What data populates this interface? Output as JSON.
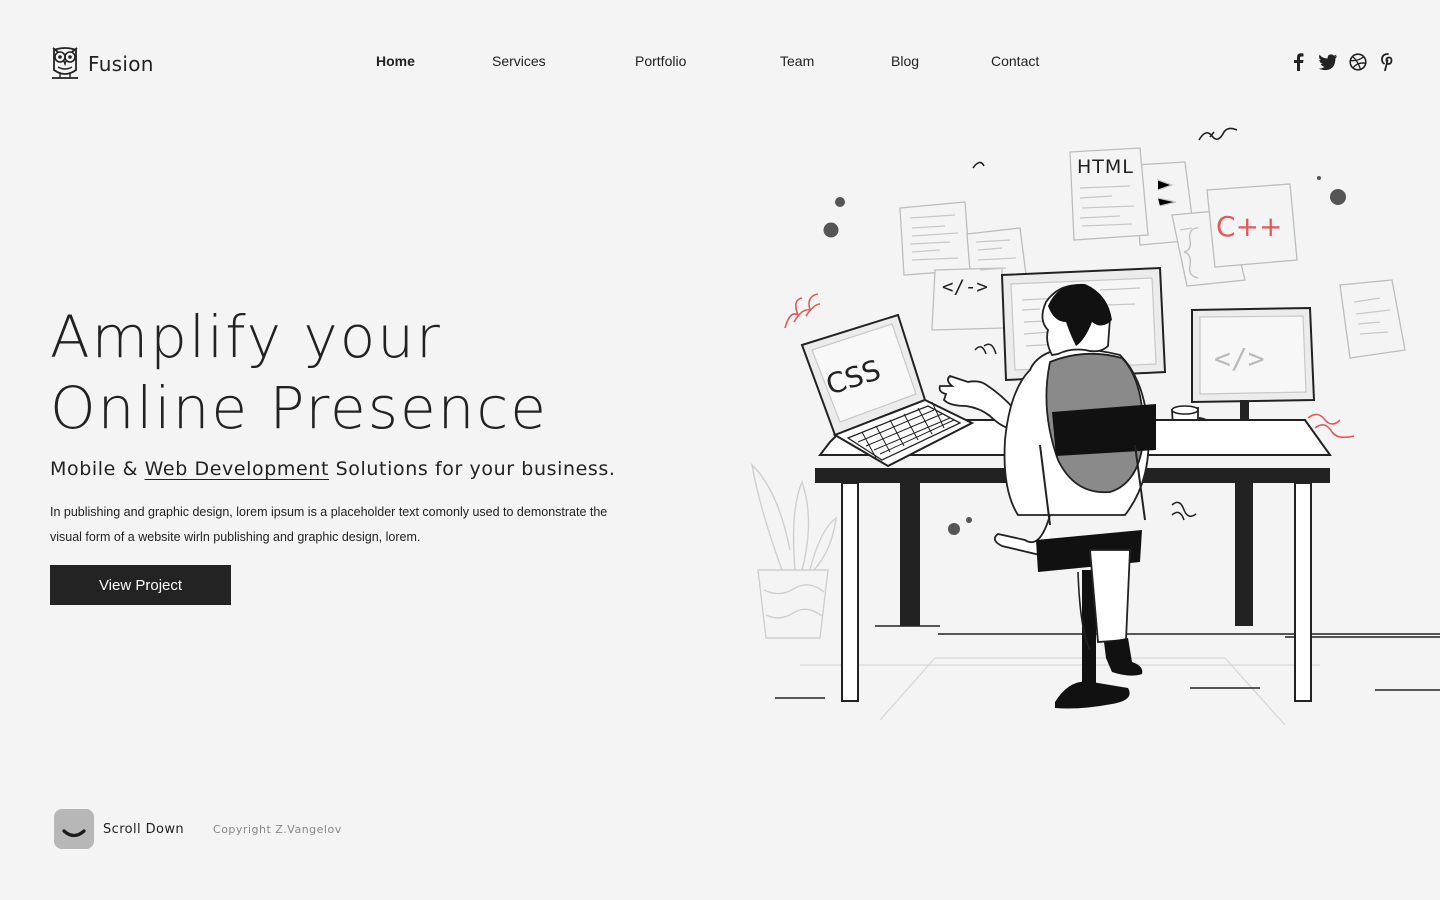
{
  "brand": {
    "name": "Fusion",
    "logo_icon": "owl-icon"
  },
  "nav": {
    "items": [
      {
        "label": "Home",
        "active": true
      },
      {
        "label": "Services",
        "active": false
      },
      {
        "label": "Portfolio",
        "active": false
      },
      {
        "label": "Team",
        "active": false
      },
      {
        "label": "Blog",
        "active": false
      },
      {
        "label": "Contact",
        "active": false
      }
    ]
  },
  "social": [
    "facebook-icon",
    "twitter-icon",
    "dribbble-icon",
    "pinterest-icon"
  ],
  "hero": {
    "title_line1": "Amplify your",
    "title_line2": "Online Presence",
    "subtitle_prefix": "Mobile & ",
    "subtitle_highlight": "Web Development",
    "subtitle_suffix": " Solutions for your business.",
    "description": "In publishing and graphic design, lorem ipsum is a placeholder text comonly used to demonstrate the visual form of a website wirln publishing and graphic design, lorem.",
    "cta_label": "View Project"
  },
  "illustration": {
    "labels": {
      "html": "HTML",
      "cpp": "C++",
      "css": "CSS",
      "code": "</>",
      "tag": "</->"
    },
    "accent_color": "#e05a5a"
  },
  "footer": {
    "scroll_label": "Scroll Down",
    "copyright": "Copyright Z.Vangelov"
  },
  "colors": {
    "background": "#f4f4f4",
    "text": "#222222",
    "button": "#232323",
    "muted": "#888888"
  }
}
